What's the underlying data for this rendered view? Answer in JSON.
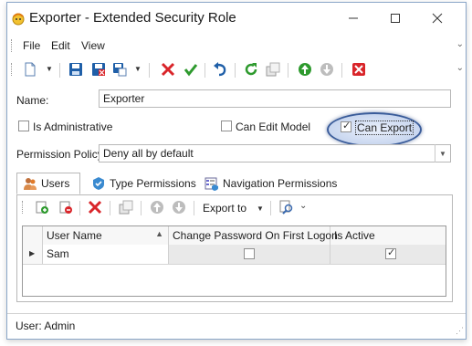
{
  "window": {
    "title": "Exporter - Extended Security Role"
  },
  "menu": {
    "items": [
      "File",
      "Edit",
      "View"
    ]
  },
  "form": {
    "name_label": "Name:",
    "name_value": "Exporter",
    "is_administrative_label": "Is Administrative",
    "is_administrative_checked": false,
    "can_edit_model_label": "Can Edit Model",
    "can_edit_model_checked": false,
    "can_export_label": "Can Export",
    "can_export_checked": true,
    "permission_policy_label": "Permission Policy:",
    "permission_policy_value": "Deny all by default"
  },
  "tabs": [
    {
      "label": "Users",
      "active": true
    },
    {
      "label": "Type Permissions",
      "active": false
    },
    {
      "label": "Navigation Permissions",
      "active": false
    }
  ],
  "grid_toolbar": {
    "export_label": "Export to"
  },
  "grid": {
    "columns": [
      "User Name",
      "Change Password On First Logon",
      "Is Active"
    ],
    "rows": [
      {
        "user_name": "Sam",
        "change_password": false,
        "is_active": true
      }
    ]
  },
  "status": {
    "text": "User: Admin"
  },
  "colors": {
    "save_blue": "#1f5fa8",
    "delete_red": "#d9252a",
    "ok_green": "#2e9a2e",
    "highlight_blue": "#3a5c9a"
  }
}
